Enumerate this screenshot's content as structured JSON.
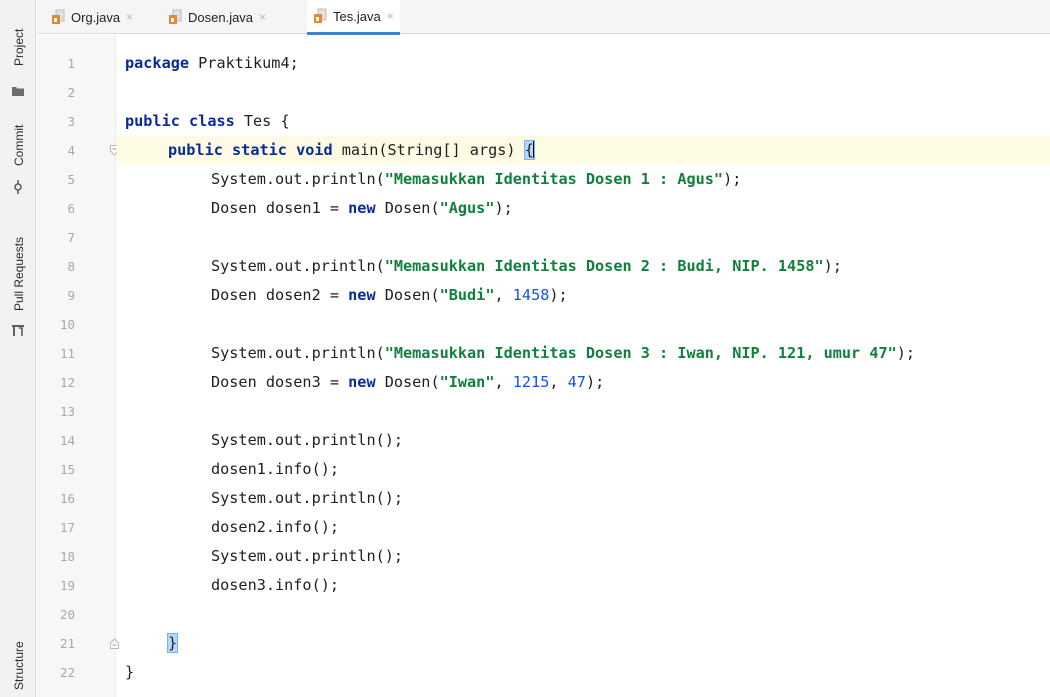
{
  "tool_strip": {
    "project_label": "Project",
    "commit_label": "Commit",
    "pull_requests_label": "Pull Requests",
    "structure_label": "Structure"
  },
  "tabs": [
    {
      "label": "Org.java",
      "close": "×",
      "active": false
    },
    {
      "label": "Dosen.java",
      "close": "×",
      "active": false
    },
    {
      "label": "Tes.java",
      "close": "×",
      "active": true
    }
  ],
  "line_numbers": [
    "1",
    "2",
    "3",
    "4",
    "5",
    "6",
    "7",
    "8",
    "9",
    "10",
    "11",
    "12",
    "13",
    "14",
    "15",
    "16",
    "17",
    "18",
    "19",
    "20",
    "21",
    "22"
  ],
  "code": {
    "l1": {
      "kw": "package",
      "rest": " Praktikum4;"
    },
    "l3": {
      "kw1": "public",
      "kw2": "class",
      "rest": " Tes {"
    },
    "l4": {
      "kw1": "public",
      "kw2": "static",
      "kw3": "void",
      "rest": " main(String[] args) ",
      "brace": "{"
    },
    "l5": {
      "pre": "System.out.println(",
      "str": "\"Memasukkan Identitas Dosen 1 : Agus\"",
      "post": ");"
    },
    "l6": {
      "pre": "Dosen dosen1 = ",
      "kw": "new",
      "mid": " Dosen(",
      "str": "\"Agus\"",
      "post": ");"
    },
    "l8": {
      "pre": "System.out.println(",
      "str": "\"Memasukkan Identitas Dosen 2 : Budi, NIP. 1458\"",
      "post": ");"
    },
    "l9": {
      "pre": "Dosen dosen2 = ",
      "kw": "new",
      "mid": " Dosen(",
      "str": "\"Budi\"",
      "sep": ", ",
      "num": "1458",
      "post": ");"
    },
    "l11": {
      "pre": "System.out.println(",
      "str": "\"Memasukkan Identitas Dosen 3 : Iwan, NIP. 121, umur 47\"",
      "post": ");"
    },
    "l12": {
      "pre": "Dosen dosen3 = ",
      "kw": "new",
      "mid": " Dosen(",
      "str": "\"Iwan\"",
      "sep1": ", ",
      "num1": "1215",
      "sep2": ", ",
      "num2": "47",
      "post": ");"
    },
    "l14": "System.out.println();",
    "l15": "dosen1.info();",
    "l16": "System.out.println();",
    "l17": "dosen2.info();",
    "l18": "System.out.println();",
    "l19": "dosen3.info();",
    "l20": {
      "brace": "}"
    },
    "l21": "}"
  },
  "colors": {
    "keyword": "#0a2a9a",
    "string": "#11803d",
    "number": "#1750eb",
    "active_tab_underline": "#4083c9",
    "current_line": "#fdfbe3"
  }
}
